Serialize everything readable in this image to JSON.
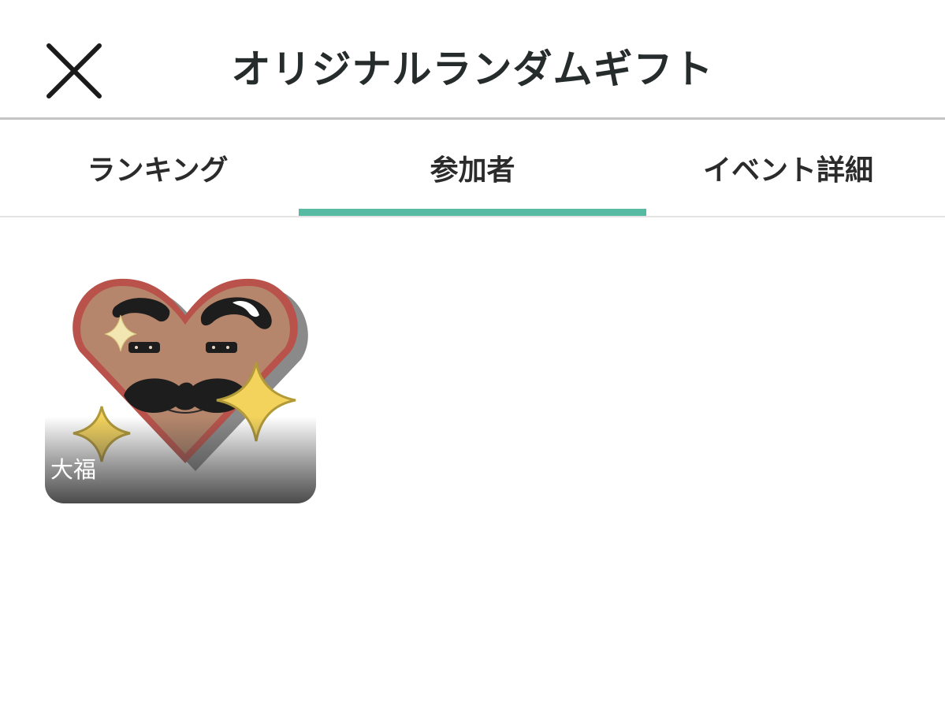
{
  "header": {
    "title": "オリジナルランダムギフト",
    "close_icon": "close-icon"
  },
  "tabs": [
    {
      "label": "ランキング",
      "active": false
    },
    {
      "label": "参加者",
      "active": true
    },
    {
      "label": "イベント詳細",
      "active": false
    }
  ],
  "participants": [
    {
      "name": "大福",
      "avatar": "heart-mustache-avatar"
    }
  ],
  "colors": {
    "accent": "#57bba3",
    "title_text": "#262b2c"
  }
}
